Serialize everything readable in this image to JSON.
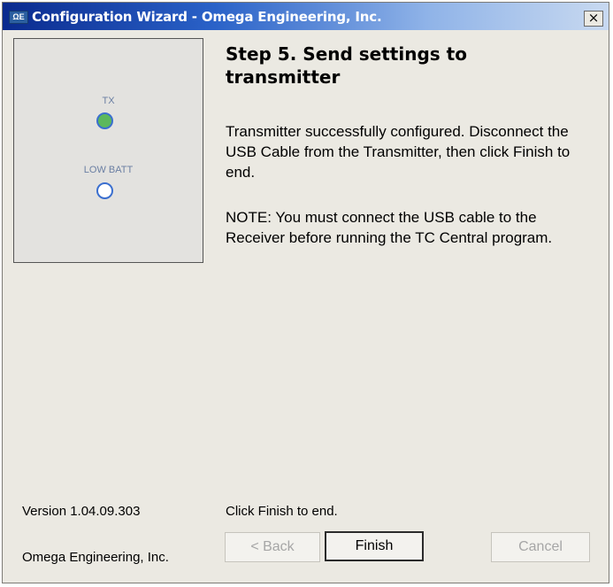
{
  "window": {
    "title": "Configuration Wizard - Omega Engineering, Inc.",
    "app_icon_text": "ΩE",
    "close_label": "×"
  },
  "leds": {
    "tx_label": "TX",
    "tx_color": "#5cb85c",
    "low_batt_label": "LOW BATT",
    "low_batt_color": "#ffffff"
  },
  "step": {
    "title": "Step 5.  Send settings to transmitter",
    "message": "Transmitter successfully configured. Disconnect the USB Cable from the Transmitter, then click Finish to end.",
    "note": "NOTE:  You must connect the USB cable to the Receiver before running the TC Central program."
  },
  "footer": {
    "version": "Version 1.04.09.303",
    "company": "Omega Engineering, Inc.",
    "hint": "Click Finish to end."
  },
  "buttons": {
    "back": "< Back",
    "finish": "Finish",
    "cancel": "Cancel"
  }
}
